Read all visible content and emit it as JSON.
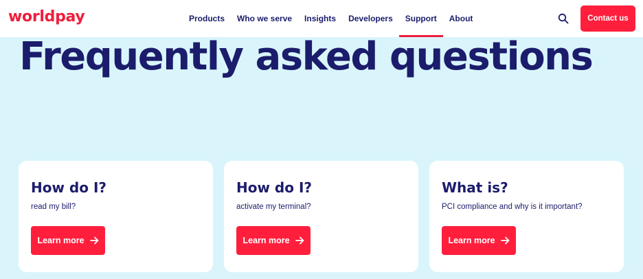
{
  "brand": {
    "logo_text": "worldpay",
    "accent_color": "#ee1e3d",
    "navy_color": "#1b1c6b"
  },
  "nav": {
    "items": [
      {
        "label": "Products"
      },
      {
        "label": "Who we serve"
      },
      {
        "label": "Insights"
      },
      {
        "label": "Developers"
      },
      {
        "label": "Support",
        "active": true
      },
      {
        "label": "About"
      }
    ]
  },
  "header": {
    "search_icon": "search-icon",
    "contact_label": "Contact us"
  },
  "page": {
    "title": "Frequently asked questions",
    "background": "#d9f5fb"
  },
  "cards": [
    {
      "title": "How do I?",
      "text": "read my bill?",
      "button_label": "Learn more",
      "button_icon": "arrow-right-icon"
    },
    {
      "title": "How do I?",
      "text": "activate my terminal?",
      "button_label": "Learn more",
      "button_icon": "arrow-right-icon"
    },
    {
      "title": "What is?",
      "text": "PCI compliance and why is it important?",
      "button_label": "Learn more",
      "button_icon": "arrow-right-icon"
    }
  ]
}
